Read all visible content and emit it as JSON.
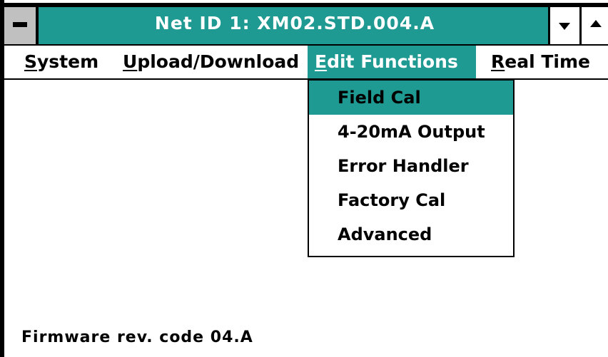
{
  "window": {
    "title": "Net ID  1: XM02.STD.004.A"
  },
  "menubar": {
    "items": [
      {
        "first": "S",
        "rest": "ystem",
        "active": false
      },
      {
        "first": "U",
        "rest": "pload/Download",
        "active": false
      },
      {
        "first": "E",
        "rest": "dit Functions",
        "active": true
      },
      {
        "first": "R",
        "rest": "eal Time",
        "active": false
      }
    ]
  },
  "dropdown": {
    "items": [
      {
        "label": "Field Cal",
        "selected": true
      },
      {
        "label": "4-20mA Output",
        "selected": false
      },
      {
        "label": "Error Handler",
        "selected": false
      },
      {
        "label": "Factory Cal",
        "selected": false
      },
      {
        "label": "Advanced",
        "selected": false
      }
    ]
  },
  "status": {
    "text": "Firmware rev. code 04.A"
  },
  "colors": {
    "accent": "#1f9a93",
    "text": "#000000",
    "background": "#ffffff"
  }
}
